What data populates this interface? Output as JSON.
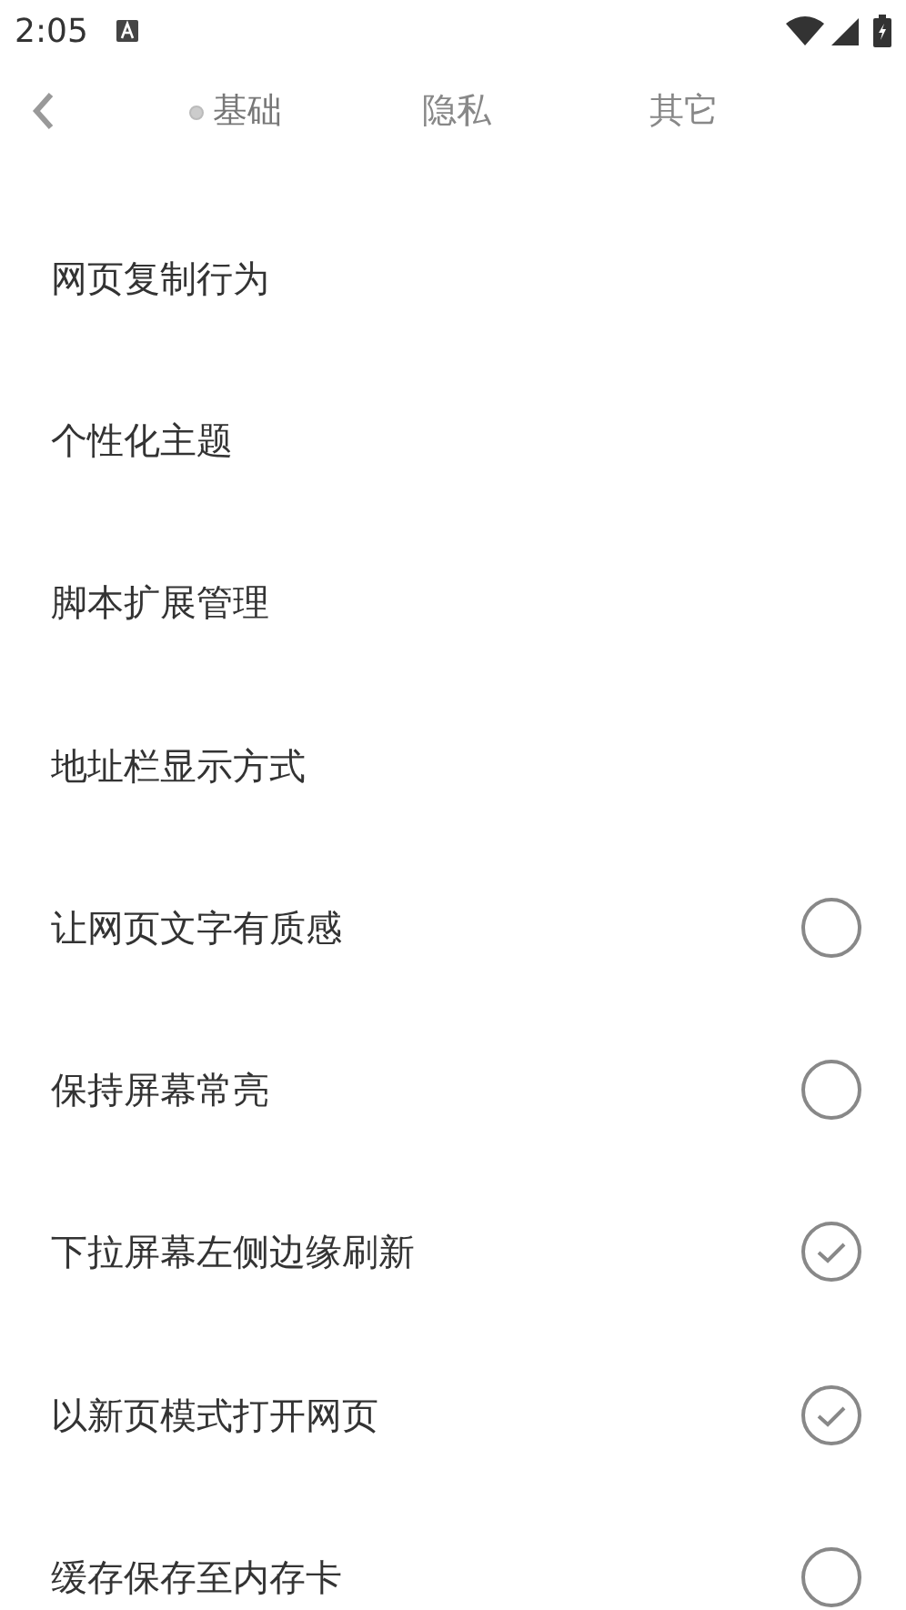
{
  "status_bar": {
    "time": "2:05"
  },
  "tabs": [
    {
      "label": "基础",
      "selected": true
    },
    {
      "label": "隐私",
      "selected": false
    },
    {
      "label": "其它",
      "selected": false
    }
  ],
  "settings": [
    {
      "kind": "link",
      "label": "网页复制行为"
    },
    {
      "kind": "link",
      "label": "个性化主题"
    },
    {
      "kind": "link",
      "label": "脚本扩展管理"
    },
    {
      "kind": "link",
      "label": "地址栏显示方式"
    },
    {
      "kind": "check",
      "label": "让网页文字有质感",
      "checked": false
    },
    {
      "kind": "check",
      "label": "保持屏幕常亮",
      "checked": false
    },
    {
      "kind": "check",
      "label": "下拉屏幕左侧边缘刷新",
      "checked": true
    },
    {
      "kind": "check",
      "label": "以新页模式打开网页",
      "checked": true
    },
    {
      "kind": "check",
      "label": "缓存保存至内存卡",
      "checked": false
    }
  ]
}
